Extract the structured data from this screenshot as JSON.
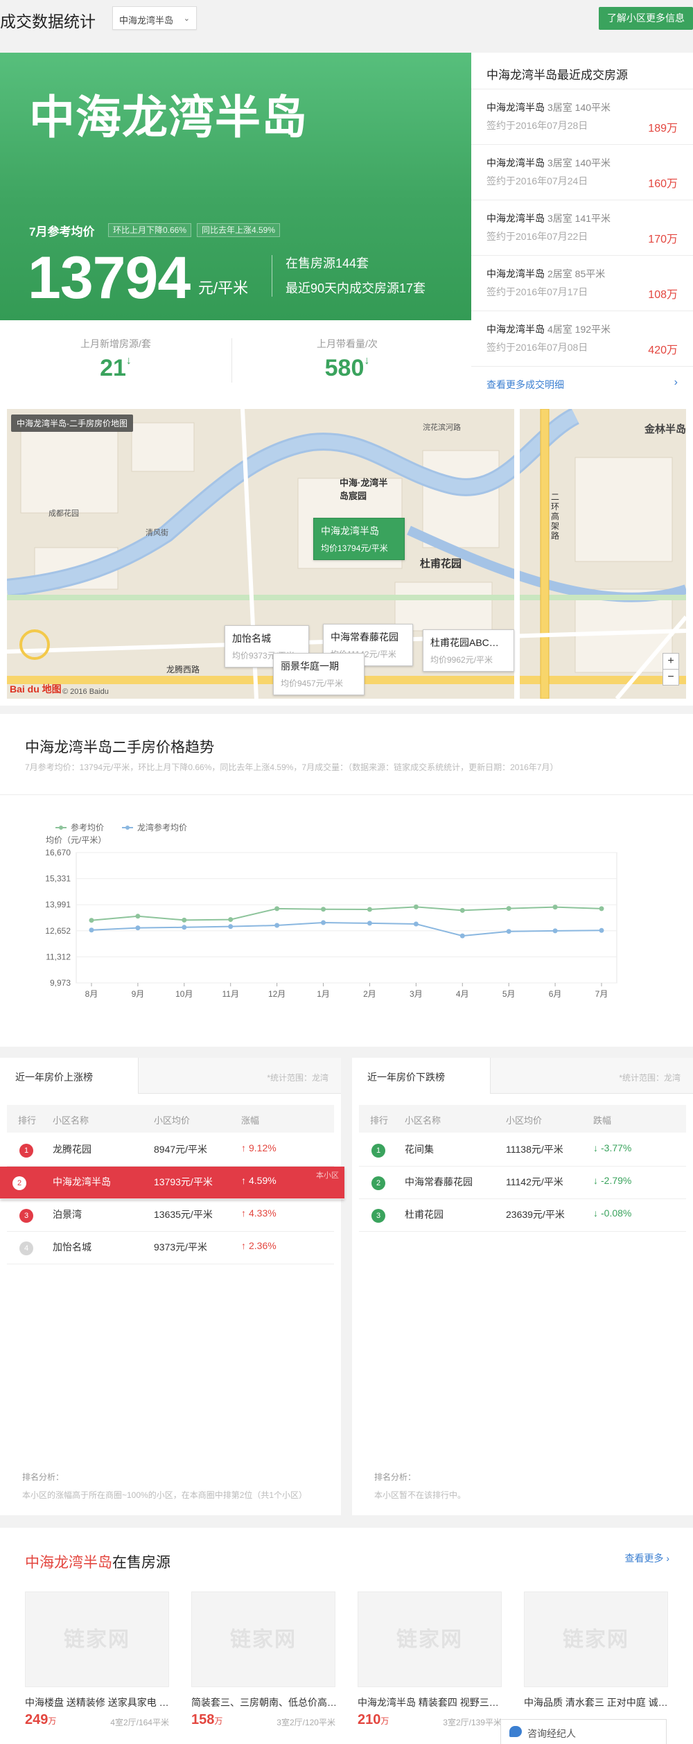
{
  "header": {
    "title": "成交数据统计",
    "community_select": "中海龙湾半岛",
    "learn_more": "了解小区更多信息"
  },
  "hero": {
    "name": "中海龙湾半岛",
    "month_label": "7月参考均价",
    "mom": "环比上月下降0.66%",
    "yoy": "同比去年上涨4.59%",
    "price": "13794",
    "unit": "元/平米",
    "on_sale": "在售房源144套",
    "sold_90": "最近90天内成交房源17套"
  },
  "stats": {
    "new_listings_label": "上月新增房源/套",
    "new_listings_value": "21",
    "viewings_label": "上月带看量/次",
    "viewings_value": "580",
    "arrow": "↓"
  },
  "deals": {
    "title": "中海龙湾半岛最近成交房源",
    "rows": [
      {
        "name": "中海龙湾半岛",
        "spec": "3居室 140平米",
        "date": "签约于2016年07月28日",
        "price": "189万"
      },
      {
        "name": "中海龙湾半岛",
        "spec": "3居室 140平米",
        "date": "签约于2016年07月24日",
        "price": "160万"
      },
      {
        "name": "中海龙湾半岛",
        "spec": "3居室 141平米",
        "date": "签约于2016年07月22日",
        "price": "170万"
      },
      {
        "name": "中海龙湾半岛",
        "spec": "2居室 85平米",
        "date": "签约于2016年07月17日",
        "price": "108万"
      },
      {
        "name": "中海龙湾半岛",
        "spec": "4居室 192平米",
        "date": "签约于2016年07月08日",
        "price": "420万"
      }
    ],
    "more": "查看更多成交明细",
    "more_arrow": "›"
  },
  "map": {
    "caption": "中海龙湾半岛-二手房房价地图",
    "popups": [
      {
        "title": "中海龙湾半岛",
        "price": "均价13794元/平米"
      },
      {
        "title": "加怡名城",
        "price": "均价9373元/平米"
      },
      {
        "title": "丽景华庭一期",
        "price": "均价9457元/平米"
      },
      {
        "title": "中海常春藤花园",
        "price": "均价11142元/平米"
      },
      {
        "title": "杜甫花园ABC…",
        "price": "均价9962元/平米"
      }
    ],
    "labels": [
      "金林半岛",
      "中海·龙湾半岛宸园",
      "杜甫花园",
      "清风街",
      "浣花滨河路",
      "成都花园",
      "龙腾西路",
      "二环高架路"
    ],
    "zoom_in": "+",
    "zoom_out": "−",
    "brand": "Bai du 地图",
    "copyright": "© 2016 Baidu"
  },
  "trend": {
    "title": "中海龙湾半岛二手房价格趋势",
    "subtitle": "7月参考均价：13794元/平米，环比上月下降0.66%，同比去年上涨4.59%，7月成交量：（数据来源：链家成交系统统计，更新日期：2016年7月）"
  },
  "chart_data": {
    "type": "line",
    "categories": [
      "8月",
      "9月",
      "10月",
      "11月",
      "12月",
      "1月",
      "2月",
      "3月",
      "4月",
      "5月",
      "6月",
      "7月"
    ],
    "series": [
      {
        "name": "参考均价",
        "color": "#8dc49b",
        "values": [
          13190,
          13400,
          13200,
          13230,
          13790,
          13760,
          13750,
          13880,
          13700,
          13800,
          13870,
          13790
        ]
      },
      {
        "name": "龙湾参考均价",
        "color": "#8ab7e0",
        "values": [
          12690,
          12800,
          12830,
          12870,
          12930,
          13070,
          13040,
          13000,
          12390,
          12620,
          12650,
          12670
        ]
      }
    ],
    "ylabel": "均价（元/平米）",
    "yticks": [
      9973,
      11312,
      12652,
      13991,
      15331,
      16670
    ],
    "ylim": [
      9973,
      16670
    ],
    "grid": true,
    "legend": "top-left"
  },
  "rank_up": {
    "tab": "近一年房价上涨榜",
    "scope": "*统计范围：龙湾",
    "headers": [
      "排行",
      "小区名称",
      "小区均价",
      "涨幅"
    ],
    "rows": [
      {
        "rank": "1",
        "name": "龙腾花园",
        "price": "8947元/平米",
        "change": "9.12%"
      },
      {
        "rank": "2",
        "name": "中海龙湾半岛",
        "price": "13793元/平米",
        "change": "4.59%"
      },
      {
        "rank": "3",
        "name": "泊景湾",
        "price": "13635元/平米",
        "change": "4.33%"
      },
      {
        "rank": "4",
        "name": "加怡名城",
        "price": "9373元/平米",
        "change": "2.36%"
      }
    ],
    "mine_tag": "本小区",
    "up_arrow": "↑",
    "foot_title": "排名分析：",
    "foot": "本小区的涨幅高于所在商圈~100%的小区，在本商圈中排第2位（共1个小区）"
  },
  "rank_down": {
    "tab": "近一年房价下跌榜",
    "scope": "*统计范围：龙湾",
    "headers": [
      "排行",
      "小区名称",
      "小区均价",
      "跌幅"
    ],
    "rows": [
      {
        "rank": "1",
        "name": "花间集",
        "price": "11138元/平米",
        "change": "-3.77%"
      },
      {
        "rank": "2",
        "name": "中海常春藤花园",
        "price": "11142元/平米",
        "change": "-2.79%"
      },
      {
        "rank": "3",
        "name": "杜甫花园",
        "price": "23639元/平米",
        "change": "-0.08%"
      }
    ],
    "down_arrow": "↓",
    "foot_title": "排名分析：",
    "foot": "本小区暂不在该排行中。"
  },
  "sale": {
    "title_name": "中海龙湾半岛",
    "title_suffix": "在售房源",
    "more": "查看更多 ›",
    "placeholder_logo": "链家网",
    "cards": [
      {
        "title": "中海楼盘 送精装修 送家具家电 …",
        "price": "249",
        "unit": "万",
        "meta": "4室2厅/164平米"
      },
      {
        "title": "简装套三、三房朝南、低总价高…",
        "price": "158",
        "unit": "万",
        "meta": "3室2厅/120平米"
      },
      {
        "title": "中海龙湾半岛 精装套四 视野三…",
        "price": "210",
        "unit": "万",
        "meta": "3室2厅/139平米"
      },
      {
        "title": "中海品质 清水套三 正对中庭 诚…",
        "price": "",
        "unit": "",
        "meta": ""
      }
    ]
  },
  "consult": {
    "label": "咨询经纪人"
  },
  "colors": {
    "green": "#3aa35d",
    "red": "#e3463f",
    "blue": "#3b7fd1"
  }
}
